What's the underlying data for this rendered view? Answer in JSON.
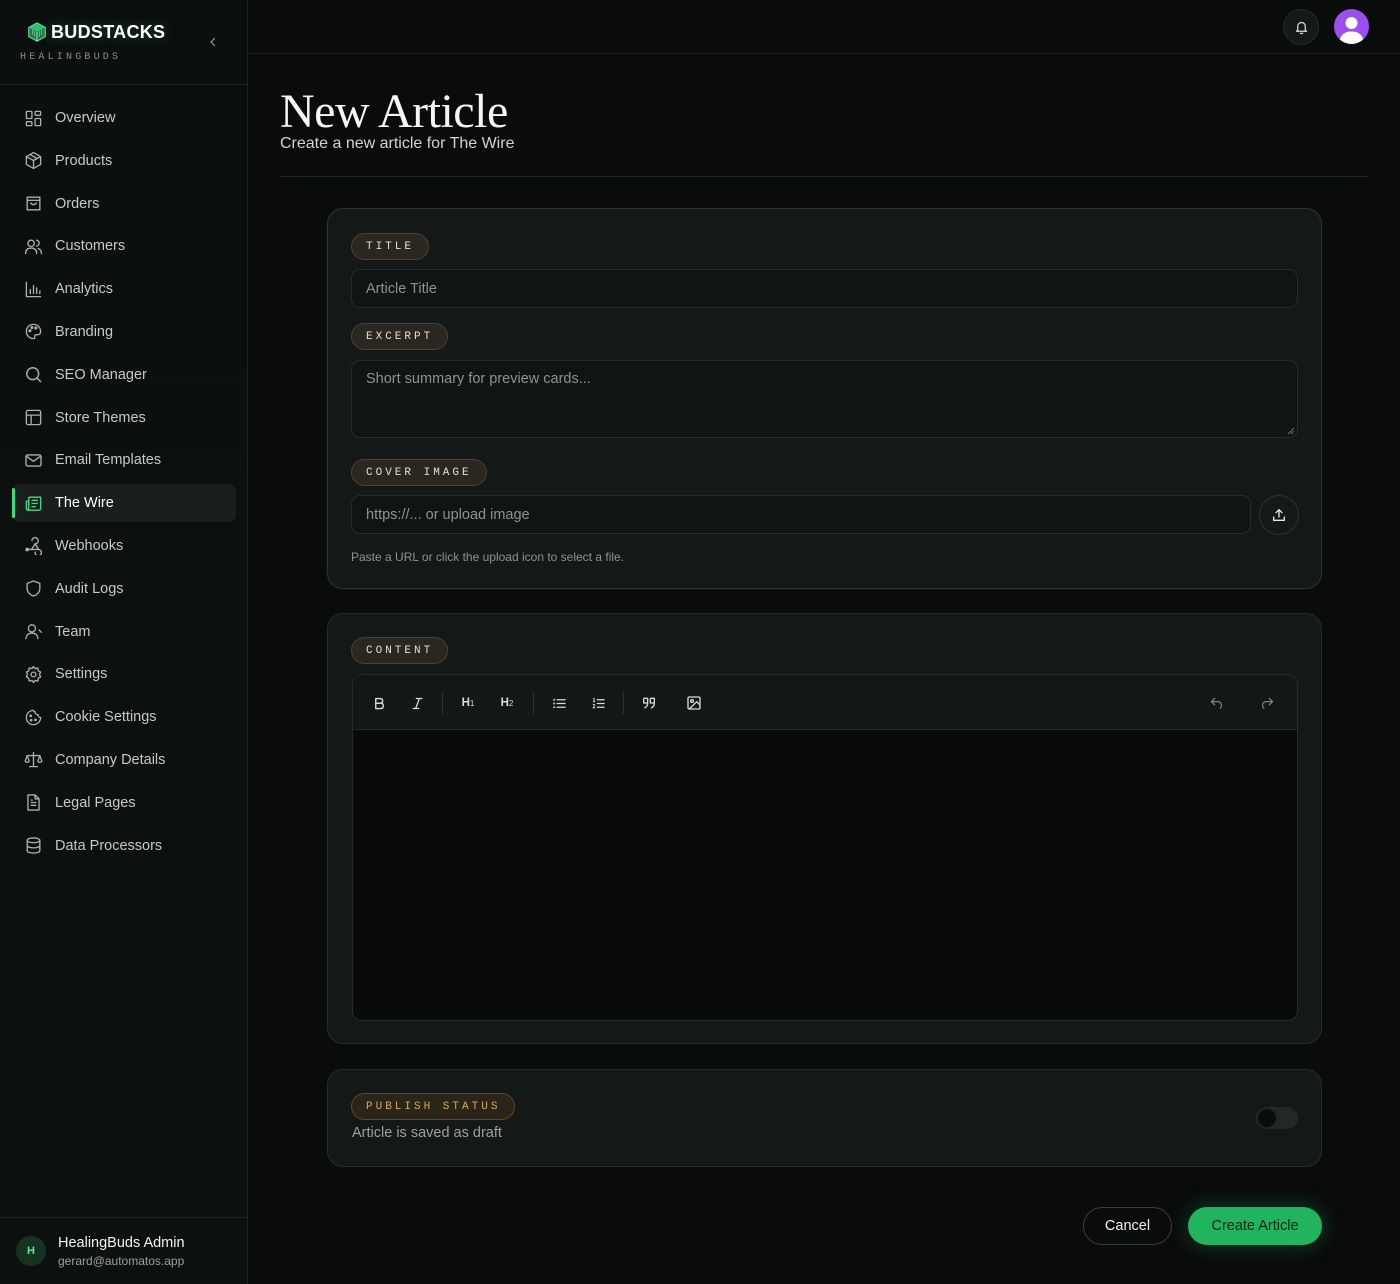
{
  "brand": {
    "name": "BUDSTACKS",
    "subtitle": "HEALINGBUDS",
    "accent": "#3ddc84"
  },
  "sidebar": {
    "items": [
      {
        "label": "Overview",
        "icon": "grid-icon"
      },
      {
        "label": "Products",
        "icon": "box-icon"
      },
      {
        "label": "Orders",
        "icon": "shopping-bag-icon"
      },
      {
        "label": "Customers",
        "icon": "users-icon"
      },
      {
        "label": "Analytics",
        "icon": "bar-chart-icon"
      },
      {
        "label": "Branding",
        "icon": "palette-icon"
      },
      {
        "label": "SEO Manager",
        "icon": "search-icon"
      },
      {
        "label": "Store Themes",
        "icon": "layout-icon"
      },
      {
        "label": "Email Templates",
        "icon": "mail-icon"
      },
      {
        "label": "The Wire",
        "icon": "newspaper-icon",
        "active": true
      },
      {
        "label": "Webhooks",
        "icon": "webhook-icon"
      },
      {
        "label": "Audit Logs",
        "icon": "shield-icon"
      },
      {
        "label": "Team",
        "icon": "user-icon"
      },
      {
        "label": "Settings",
        "icon": "gear-icon"
      },
      {
        "label": "Cookie Settings",
        "icon": "cookie-icon"
      },
      {
        "label": "Company Details",
        "icon": "scale-icon"
      },
      {
        "label": "Legal Pages",
        "icon": "file-text-icon"
      },
      {
        "label": "Data Processors",
        "icon": "database-icon"
      }
    ],
    "user": {
      "initial": "H",
      "name": "HealingBuds Admin",
      "email": "gerard@automatos.app"
    }
  },
  "page": {
    "title": "New Article",
    "subtitle": "Create a new article for The Wire"
  },
  "form": {
    "title_label": "TITLE",
    "title_placeholder": "Article Title",
    "excerpt_label": "EXCERPT",
    "excerpt_placeholder": "Short summary for preview cards...",
    "cover_label": "COVER IMAGE",
    "cover_placeholder": "https://... or upload image",
    "cover_hint": "Paste a URL or click the upload icon to select a file.",
    "content_label": "CONTENT",
    "toolbar": {
      "bold": "bold-icon",
      "italic": "italic-icon",
      "h1": "H",
      "h1_sub": "1",
      "h2": "H",
      "h2_sub": "2",
      "bullet_list": "bullet-list-icon",
      "ordered_list": "ordered-list-icon",
      "quote": "quote-icon",
      "image": "image-icon",
      "undo": "undo-icon",
      "redo": "redo-icon"
    },
    "status_label": "PUBLISH STATUS",
    "status_text": "Article is saved as draft",
    "published": false
  },
  "actions": {
    "cancel": "Cancel",
    "create": "Create Article"
  }
}
